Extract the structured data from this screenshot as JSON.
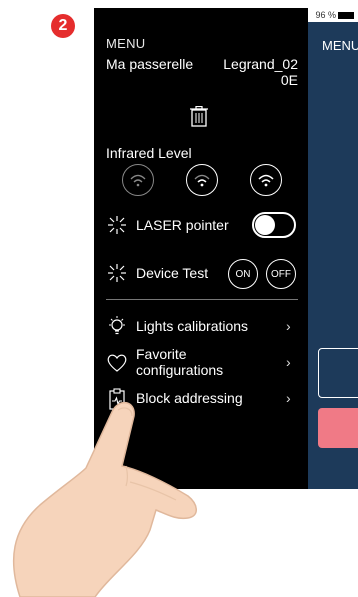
{
  "step_badge": "2",
  "status": {
    "battery": "96 %"
  },
  "background_screen": {
    "menu_label": "MENU"
  },
  "sidebar": {
    "title": "MENU",
    "gateway_label": "Ma passerelle",
    "gateway_value": "Legrand_020E",
    "infrared_label": "Infrared Level",
    "laser_label": "LASER pointer",
    "device_test_label": "Device Test",
    "on_label": "ON",
    "off_label": "OFF",
    "items": [
      {
        "label": "Lights calibrations"
      },
      {
        "label": "Favorite configurations"
      },
      {
        "label": "Block addressing"
      }
    ]
  },
  "colors": {
    "badge": "#e52d2d",
    "panel": "#000000",
    "behind": "#1d3a5a",
    "accent_red": "#f07a86"
  }
}
